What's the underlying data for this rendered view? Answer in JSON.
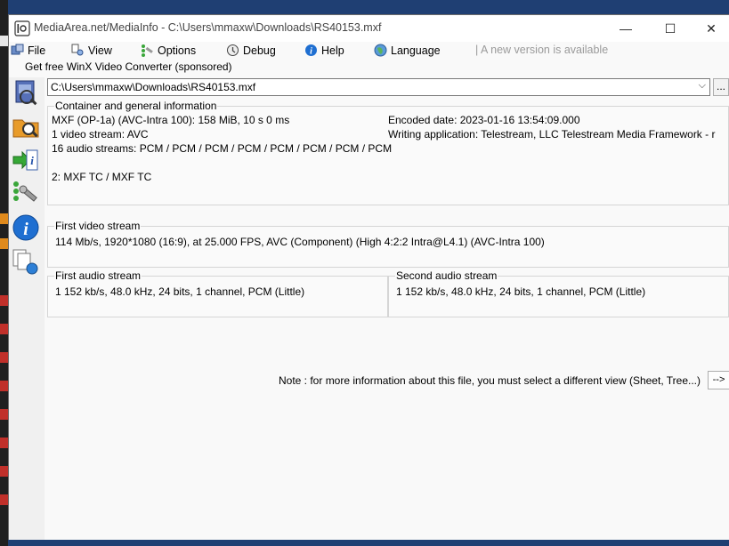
{
  "window": {
    "title": "MediaArea.net/MediaInfo - C:\\Users\\mmaxw\\Downloads\\RS40153.mxf",
    "minimize_glyph": "—",
    "maximize_glyph": "☐",
    "close_glyph": "✕"
  },
  "menu": {
    "items": [
      {
        "label": "File",
        "icon": "file-menu-icon"
      },
      {
        "label": "View",
        "icon": "view-menu-icon"
      },
      {
        "label": "Options",
        "icon": "options-menu-icon"
      },
      {
        "label": "Debug",
        "icon": "debug-menu-icon"
      },
      {
        "label": "Help",
        "icon": "help-menu-icon"
      },
      {
        "label": "Language",
        "icon": "language-menu-icon"
      }
    ],
    "update_notice": "| A new version is available"
  },
  "sponsored_link": "Get free WinX Video Converter (sponsored)",
  "sidebar": {
    "buttons": [
      "open-file-icon",
      "open-folder-icon",
      "export-icon",
      "preferences-icon",
      "about-icon",
      "knowledge-base-icon"
    ]
  },
  "file_selector": {
    "value": "C:\\Users\\mmaxw\\Downloads\\RS40153.mxf",
    "dropdown_glyph": "⌵",
    "browse_label": "..."
  },
  "general": {
    "title": "Container and general information",
    "left_lines": [
      "MXF (OP-1a) (AVC-Intra 100): 158 MiB, 10 s 0 ms",
      "1 video stream: AVC",
      "16 audio streams: PCM / PCM / PCM / PCM / PCM / PCM / PCM / PCM",
      "",
      "2: MXF TC / MXF TC"
    ],
    "right_lines": [
      "Encoded date: 2023-01-16 13:54:09.000",
      "Writing application: Telestream, LLC Telestream Media Framework - r"
    ]
  },
  "video": {
    "title": "First video stream",
    "line": "114 Mb/s, 1920*1080 (16:9), at 25.000 FPS, AVC (Component) (High 4:2:2 Intra@L4.1) (AVC-Intra 100)"
  },
  "audio1": {
    "title": "First audio stream",
    "line": "1 152 kb/s, 48.0 kHz, 24 bits, 1 channel, PCM (Little)"
  },
  "audio2": {
    "title": "Second audio stream",
    "line": "1 152 kb/s, 48.0 kHz, 24 bits, 1 channel, PCM (Little)"
  },
  "note": {
    "text": "Note : for more information about this file, you must select a different view (Sheet, Tree...)",
    "button_label": "-->"
  },
  "colors": {
    "desktop": "#1f3f73",
    "window_bg": "#f9f9f9",
    "group_border": "#d5d5d5",
    "accent_blue": "#1f6fd1"
  }
}
